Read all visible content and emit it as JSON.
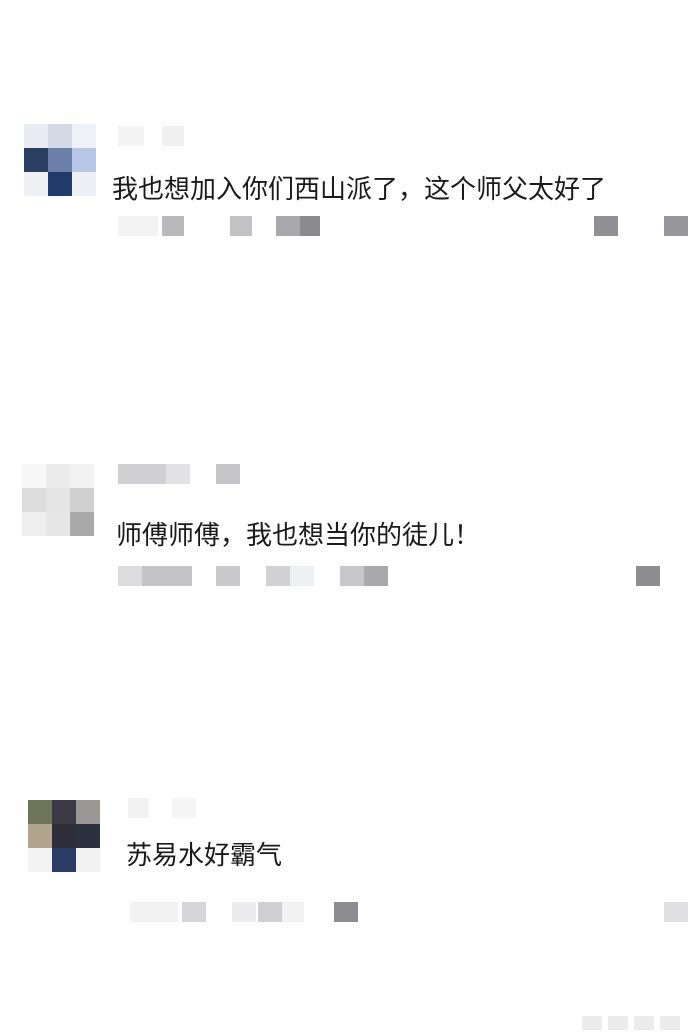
{
  "comments": [
    {
      "text": "我也想加入你们西山派了，这个师父太好了"
    },
    {
      "text": "师傅师傅，我也想当你的徒儿！"
    },
    {
      "text": "苏易水好霸气"
    }
  ]
}
